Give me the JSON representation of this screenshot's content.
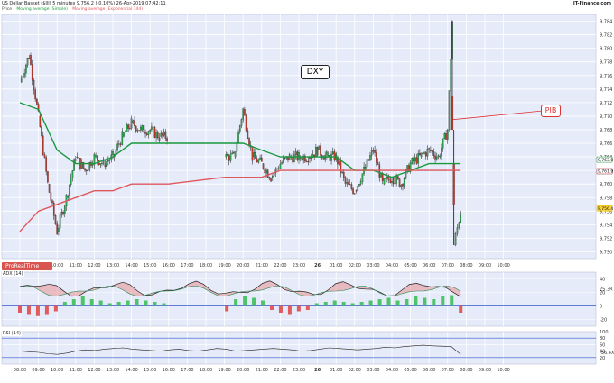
{
  "header": {
    "instrument": "US Dollar Basket ($Ill)",
    "timeframe": "5 minutes",
    "last": "9,756.2 (-0.10%)",
    "datetime": "26-Apr-2019 07:42:11",
    "provider": "IT-Finance.com"
  },
  "legend": {
    "price": "Price",
    "ma1": "Moving average (Simple)",
    "ma2": "Moving average (Exponential 144)"
  },
  "labels": {
    "dxy": "DXY",
    "pib": "PIB",
    "prorealtime": "ProRealTime",
    "adx": "ADX (14)",
    "rsi": "RSI (14)"
  },
  "colors": {
    "price_up": "#2ea44f",
    "price_down": "#c0392b",
    "ma_green": "#1a9a3c",
    "ma_red": "#e0575c",
    "hist_up": "#3cbf5a",
    "hist_down": "#e04a4a",
    "panel_bg": "#e6ebfa"
  },
  "chart_data": [
    {
      "type": "candlestick",
      "title": "DXY",
      "ylim": [
        9.749,
        9.785
      ],
      "y_ticks": [
        "9,784",
        "9,782",
        "9,780",
        "9,778",
        "9,776",
        "9,774",
        "9,772",
        "9,770",
        "9,768",
        "9,766",
        "9,764",
        "9,762",
        "9,760",
        "9,758",
        "9,756",
        "9,754",
        "9,752",
        "9,750"
      ],
      "x_ticks": [
        "08:00",
        "09:00",
        "10:00",
        "11:00",
        "12:00",
        "13:00",
        "14:00",
        "15:00",
        "16:00",
        "17:00",
        "18:00",
        "19:00",
        "20:00",
        "21:00",
        "22:00",
        "23:00",
        "26",
        "01:00",
        "02:00",
        "03:00",
        "04:00",
        "05:00",
        "06:00",
        "07:00",
        "08:00",
        "09:00",
        "10:00"
      ],
      "price_labels": [
        "9,763.0",
        "9,762.2",
        "9,761.9",
        "9,756.4"
      ],
      "close_path": [
        [
          "08:00",
          9.775
        ],
        [
          "08:30",
          9.779
        ],
        [
          "09:00",
          9.77
        ],
        [
          "09:30",
          9.76
        ],
        [
          "10:00",
          9.753
        ],
        [
          "10:30",
          9.758
        ],
        [
          "11:00",
          9.764
        ],
        [
          "11:30",
          9.762
        ],
        [
          "12:00",
          9.764
        ],
        [
          "12:30",
          9.763
        ],
        [
          "13:00",
          9.764
        ],
        [
          "13:30",
          9.767
        ],
        [
          "14:00",
          9.769
        ],
        [
          "14:30",
          9.768
        ],
        [
          "15:00",
          9.768
        ],
        [
          "15:30",
          9.767
        ],
        [
          "15:55",
          9.767
        ],
        [
          "19:00",
          9.764
        ],
        [
          "19:30",
          9.764
        ],
        [
          "20:00",
          9.771
        ],
        [
          "20:30",
          9.764
        ],
        [
          "21:00",
          9.763
        ],
        [
          "21:30",
          9.761
        ],
        [
          "22:00",
          9.763
        ],
        [
          "22:30",
          9.764
        ],
        [
          "23:00",
          9.764
        ],
        [
          "23:30",
          9.764
        ],
        [
          "00:00",
          9.765
        ],
        [
          "00:30",
          9.764
        ],
        [
          "01:00",
          9.764
        ],
        [
          "01:30",
          9.76
        ],
        [
          "02:00",
          9.759
        ],
        [
          "02:30",
          9.762
        ],
        [
          "03:00",
          9.765
        ],
        [
          "03:30",
          9.76
        ],
        [
          "04:00",
          9.761
        ],
        [
          "04:30",
          9.76
        ],
        [
          "05:00",
          9.763
        ],
        [
          "05:30",
          9.764
        ],
        [
          "06:00",
          9.765
        ],
        [
          "06:30",
          9.764
        ],
        [
          "07:00",
          9.768
        ],
        [
          "07:15",
          9.784
        ],
        [
          "07:20",
          9.751
        ],
        [
          "07:42",
          9.756
        ]
      ],
      "ma_green": [
        [
          "08:00",
          9.772
        ],
        [
          "09:00",
          9.771
        ],
        [
          "10:00",
          9.765
        ],
        [
          "11:00",
          9.763
        ],
        [
          "12:00",
          9.763
        ],
        [
          "13:00",
          9.764
        ],
        [
          "14:00",
          9.766
        ],
        [
          "15:00",
          9.766
        ],
        [
          "16:00",
          9.766
        ],
        [
          "19:00",
          9.766
        ],
        [
          "20:00",
          9.766
        ],
        [
          "21:00",
          9.765
        ],
        [
          "22:00",
          9.764
        ],
        [
          "23:00",
          9.764
        ],
        [
          "00:00",
          9.764
        ],
        [
          "01:00",
          9.764
        ],
        [
          "02:00",
          9.762
        ],
        [
          "03:00",
          9.762
        ],
        [
          "04:00",
          9.761
        ],
        [
          "05:00",
          9.762
        ],
        [
          "06:00",
          9.763
        ],
        [
          "07:00",
          9.763
        ],
        [
          "07:42",
          9.763
        ]
      ],
      "ma_red": [
        [
          "08:00",
          9.753
        ],
        [
          "09:00",
          9.756
        ],
        [
          "10:00",
          9.757
        ],
        [
          "11:00",
          9.758
        ],
        [
          "12:00",
          9.759
        ],
        [
          "13:00",
          9.759
        ],
        [
          "14:00",
          9.76
        ],
        [
          "15:00",
          9.76
        ],
        [
          "16:00",
          9.76
        ],
        [
          "19:00",
          9.761
        ],
        [
          "20:00",
          9.761
        ],
        [
          "21:00",
          9.761
        ],
        [
          "22:00",
          9.762
        ],
        [
          "23:00",
          9.762
        ],
        [
          "00:00",
          9.762
        ],
        [
          "01:00",
          9.762
        ],
        [
          "02:00",
          9.762
        ],
        [
          "03:00",
          9.762
        ],
        [
          "04:00",
          9.762
        ],
        [
          "05:00",
          9.762
        ],
        [
          "06:00",
          9.762
        ],
        [
          "07:00",
          9.762
        ],
        [
          "07:42",
          9.762
        ]
      ]
    },
    {
      "type": "area",
      "title": "ADX (14)",
      "ylim": [
        -30,
        50
      ],
      "y_ticks": [
        "40",
        "25.3R",
        "20",
        "0",
        "-20"
      ],
      "price_labels": [
        "25.3R"
      ],
      "histogram": [
        -10,
        -12,
        -15,
        -12,
        -8,
        6,
        10,
        14,
        10,
        8,
        4,
        6,
        8,
        10,
        8,
        6,
        4,
        5,
        6,
        5,
        4,
        -8,
        -12,
        -8,
        10,
        14,
        12,
        8,
        -6,
        -10,
        -12,
        -8,
        -6,
        4,
        6,
        8,
        6,
        4,
        6,
        8,
        10,
        12,
        8,
        10,
        14,
        12,
        10,
        14,
        16,
        -10
      ]
    },
    {
      "type": "line",
      "title": "RSI (14)",
      "ylim": [
        0,
        100
      ],
      "y_ticks": [
        "100",
        "80",
        "60",
        "40",
        "20",
        "-36.4XX"
      ],
      "price_labels": [
        "-36.4XX"
      ],
      "values": [
        40,
        38,
        36,
        32,
        30,
        34,
        40,
        44,
        42,
        46,
        48,
        50,
        46,
        44,
        42,
        40,
        44,
        46,
        42,
        40,
        44,
        48,
        46,
        40,
        42,
        44,
        46,
        48,
        46,
        44,
        40,
        42,
        46,
        50,
        48,
        46,
        44,
        46,
        48,
        52,
        50,
        54,
        56,
        58,
        56,
        55,
        54,
        30
      ]
    }
  ]
}
